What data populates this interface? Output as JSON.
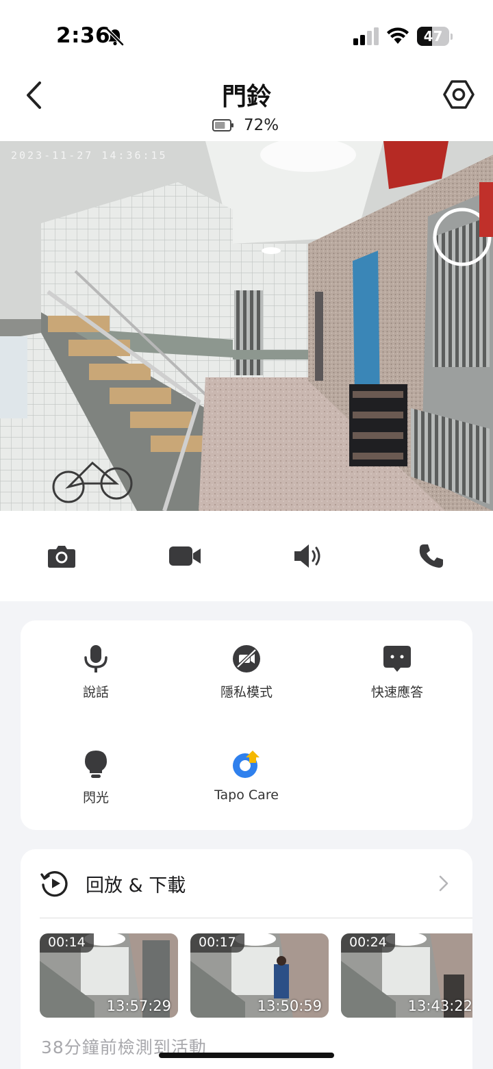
{
  "status_bar": {
    "time": "2:36",
    "battery_level": "47",
    "battery_fraction": 0.47
  },
  "header": {
    "title": "門鈴",
    "device_battery": "72%",
    "device_battery_fraction": 0.72
  },
  "camera": {
    "timestamp": "2023-11-27 14:36:15"
  },
  "quick_controls": [
    {
      "name": "snapshot",
      "icon": "camera-icon"
    },
    {
      "name": "record",
      "icon": "video-camera-icon"
    },
    {
      "name": "speaker",
      "icon": "speaker-icon"
    },
    {
      "name": "call",
      "icon": "phone-icon"
    }
  ],
  "features": [
    {
      "label": "說話",
      "icon": "microphone-icon"
    },
    {
      "label": "隱私模式",
      "icon": "privacy-mode-icon"
    },
    {
      "label": "快速應答",
      "icon": "quick-reply-icon"
    },
    {
      "label": "閃光",
      "icon": "light-bulb-icon"
    },
    {
      "label": "Tapo Care",
      "icon": "tapo-care-icon"
    }
  ],
  "playback": {
    "title": "回放 & 下載",
    "clips": [
      {
        "duration": "00:14",
        "time": "13:57:29"
      },
      {
        "duration": "00:17",
        "time": "13:50:59"
      },
      {
        "duration": "00:24",
        "time": "13:43:22"
      }
    ],
    "activity_text": "38分鐘前檢測到活動"
  },
  "colors": {
    "accent_blue": "#2f80ed",
    "tapo_yellow": "#f5b800",
    "icon_dark": "#3a3a3c",
    "background": "#f3f4f7"
  }
}
